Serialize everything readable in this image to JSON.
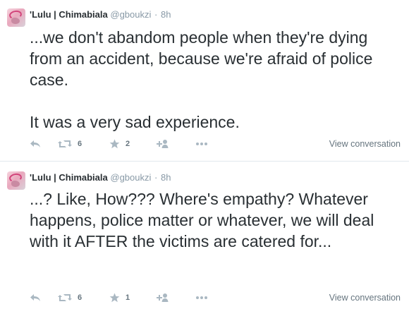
{
  "tweets": [
    {
      "name": "'Lulu | Chimabiala",
      "handle": "@gboukzi",
      "separator": "·",
      "time": "8h",
      "text": "...we don't abandom people when they're dying from an accident, because we're afraid of police case.\n\nIt was a very sad experience.",
      "retweets": "6",
      "favorites": "2",
      "view_conversation": "View conversation"
    },
    {
      "name": "'Lulu | Chimabiala",
      "handle": "@gboukzi",
      "separator": "·",
      "time": "8h",
      "text": "...? Like, How??? Where's empathy? Whatever happens, police matter or whatever, we will deal with it AFTER the victims are catered for...",
      "retweets": "6",
      "favorites": "1",
      "view_conversation": "View conversation"
    }
  ],
  "icons": {
    "reply": "reply-icon",
    "retweet": "retweet-icon",
    "favorite": "star-icon",
    "follow": "follow-icon",
    "more": "more-icon"
  },
  "colors": {
    "text": "#292f33",
    "muted": "#8899a6",
    "icon": "#aab8c2",
    "divider": "#e1e8ed"
  }
}
